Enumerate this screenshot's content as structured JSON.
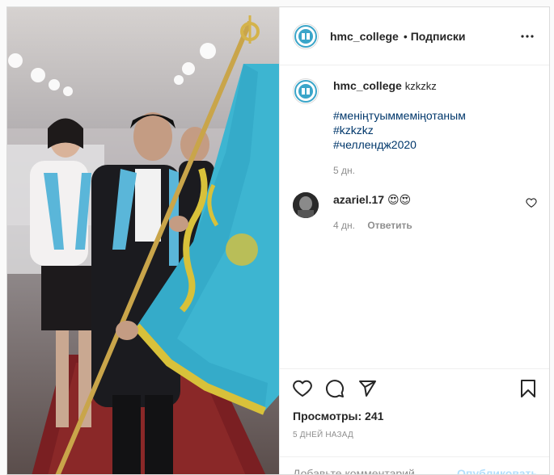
{
  "header": {
    "username": "hmc_college",
    "dot": "•",
    "follow_label": "Подписки"
  },
  "caption": {
    "username": "hmc_college",
    "text": "kzkzkz",
    "hashtags": [
      "#меніңтуыммеміңотаным",
      "#kzkzkz",
      "#челлендж2020"
    ],
    "time": "5 дн."
  },
  "comment": {
    "username": "azariel.17",
    "emojis": "😍😍",
    "time": "4 дн.",
    "reply_label": "Ответить"
  },
  "stats": {
    "views": "Просмотры: 241",
    "date": "5 дней назад"
  },
  "add_comment": {
    "placeholder": "Добавьте комментарий...",
    "publish_label": "Опубликовать"
  },
  "icons": {
    "more": "more-horizontal-icon",
    "like": "heart-icon",
    "comment": "comment-bubble-icon",
    "share": "paper-plane-icon",
    "save": "bookmark-icon",
    "comment_like": "heart-icon"
  },
  "colors": {
    "flag_blue": "#3db5d1",
    "flag_gold": "#d8c13a",
    "hashtag": "#00376b",
    "muted": "#8e8e8e",
    "publish_disabled": "#b2dffc"
  }
}
